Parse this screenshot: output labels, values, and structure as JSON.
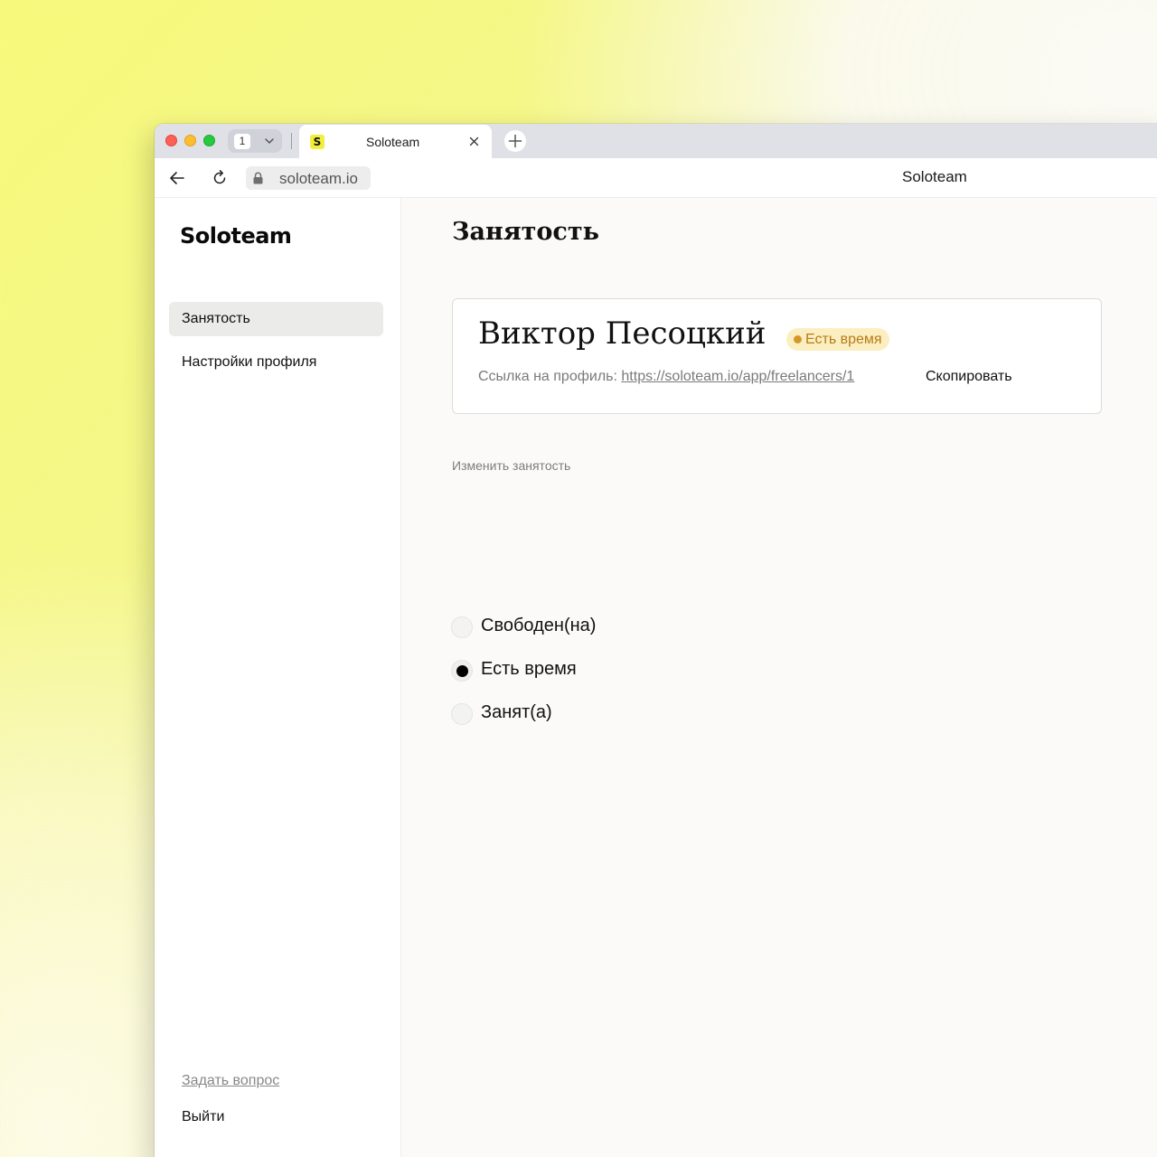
{
  "browser": {
    "tab_count": "1",
    "tab": {
      "title": "Soloteam",
      "favicon_letter": "S"
    },
    "url": "soloteam.io",
    "page_title": "Soloteam"
  },
  "sidebar": {
    "logo": "Soloteam",
    "items": [
      {
        "label": "Занятость",
        "active": true
      },
      {
        "label": "Настройки профиля",
        "active": false
      }
    ],
    "ask_label": "Задать вопрос",
    "logout_label": "Выйти"
  },
  "main": {
    "title": "Занятость",
    "card": {
      "name": "Виктор Песоцкий",
      "badge": "Есть время",
      "link_label": "Ссылка на профиль:",
      "link_url": "https://soloteam.io/app/freelancers/1",
      "copy_label": "Скопировать"
    },
    "availability": {
      "label": "Изменить занятость",
      "options": [
        {
          "label": "Свободен(на)",
          "checked": false
        },
        {
          "label": "Есть время",
          "checked": true
        },
        {
          "label": "Занят(а)",
          "checked": false
        }
      ]
    }
  },
  "colors": {
    "badge_bg": "#fbefc2",
    "badge_text": "#b87a16",
    "favicon_bg": "#f2ee3a",
    "active_nav_bg": "#ebebea"
  }
}
